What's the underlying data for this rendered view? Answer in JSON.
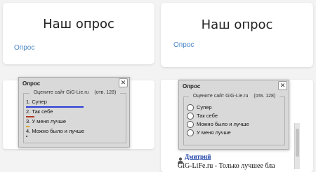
{
  "cards": [
    {
      "title": "Наш опрос",
      "link": "Опрос"
    },
    {
      "title": "Наш опрос",
      "link": "Опрос"
    }
  ],
  "poll_results": {
    "window_title": "Опрос",
    "question": "Оцените сайт GiG-Lie.ru",
    "votes": "(отв. 128)",
    "items": [
      {
        "label": "1. Супер",
        "fraction": 0.82,
        "color": "#2b3cd6"
      },
      {
        "label": "2. Так себе",
        "fraction": 0.12,
        "color": "#b23a1f"
      },
      {
        "label": "3. У меня лучше",
        "fraction": 0.05,
        "color": "#d6a62b"
      },
      {
        "label": "4. Можно было и лучше",
        "fraction": 0.02,
        "color": "#555555"
      }
    ]
  },
  "poll_vote": {
    "window_title": "Опрос",
    "question": "Оцените сайт GiG-Lie.ru",
    "votes": "(отв. 128)",
    "options": [
      "Супер",
      "Так себе",
      "Можно было и лучше",
      "У меня лучше"
    ]
  },
  "comment": {
    "author": "Дмитрий",
    "text": "GiG-LiFe.ru - Только лучшее бла"
  },
  "icons": {
    "close": "close-icon",
    "user": "user-icon"
  }
}
